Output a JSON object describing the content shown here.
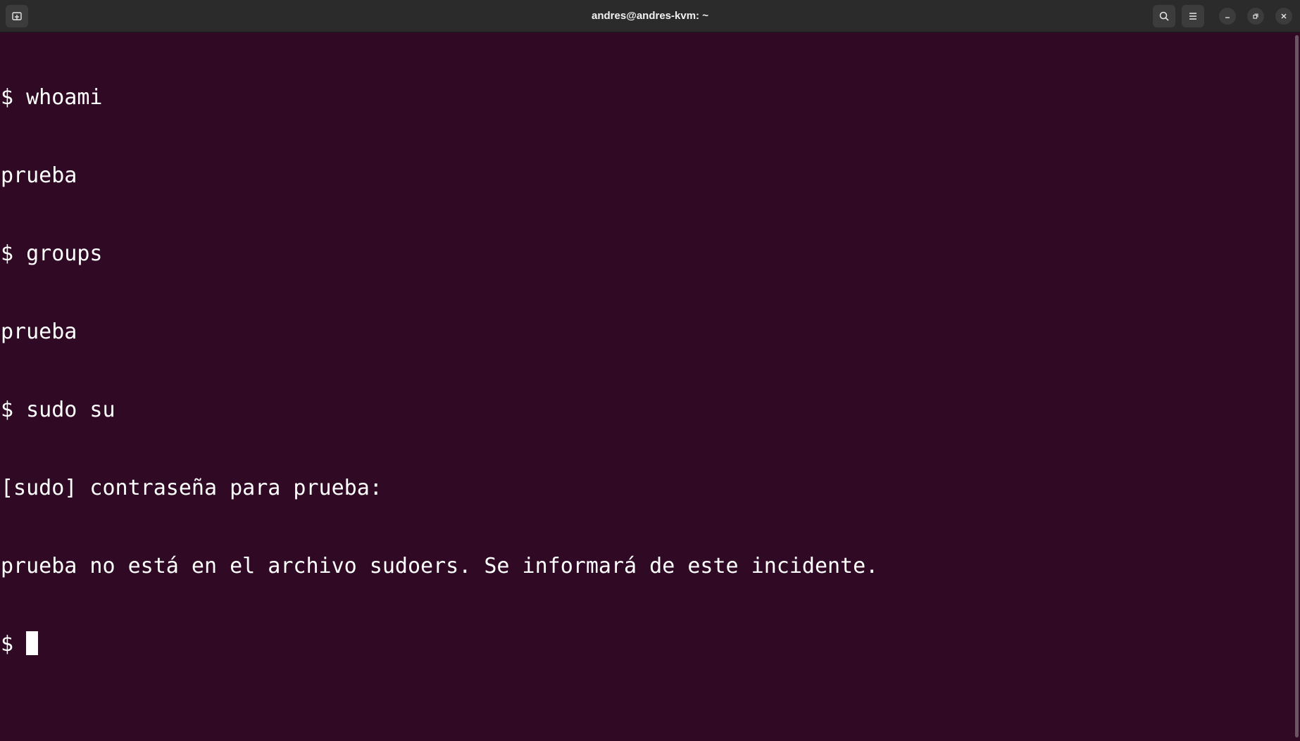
{
  "window": {
    "title": "andres@andres-kvm: ~"
  },
  "titlebar": {
    "icons": {
      "new_tab": "new-tab-icon",
      "search": "search-icon",
      "menu": "hamburger-menu-icon",
      "minimize": "minimize-icon",
      "maximize": "restore-icon",
      "close": "close-icon"
    }
  },
  "terminal": {
    "lines": [
      "$ whoami",
      "prueba",
      "$ groups",
      "prueba",
      "$ sudo su",
      "[sudo] contraseña para prueba:",
      "prueba no está en el archivo sudoers. Se informará de este incidente."
    ],
    "prompt": "$ ",
    "colors": {
      "background": "#300a24",
      "foreground": "#ffffff"
    }
  }
}
